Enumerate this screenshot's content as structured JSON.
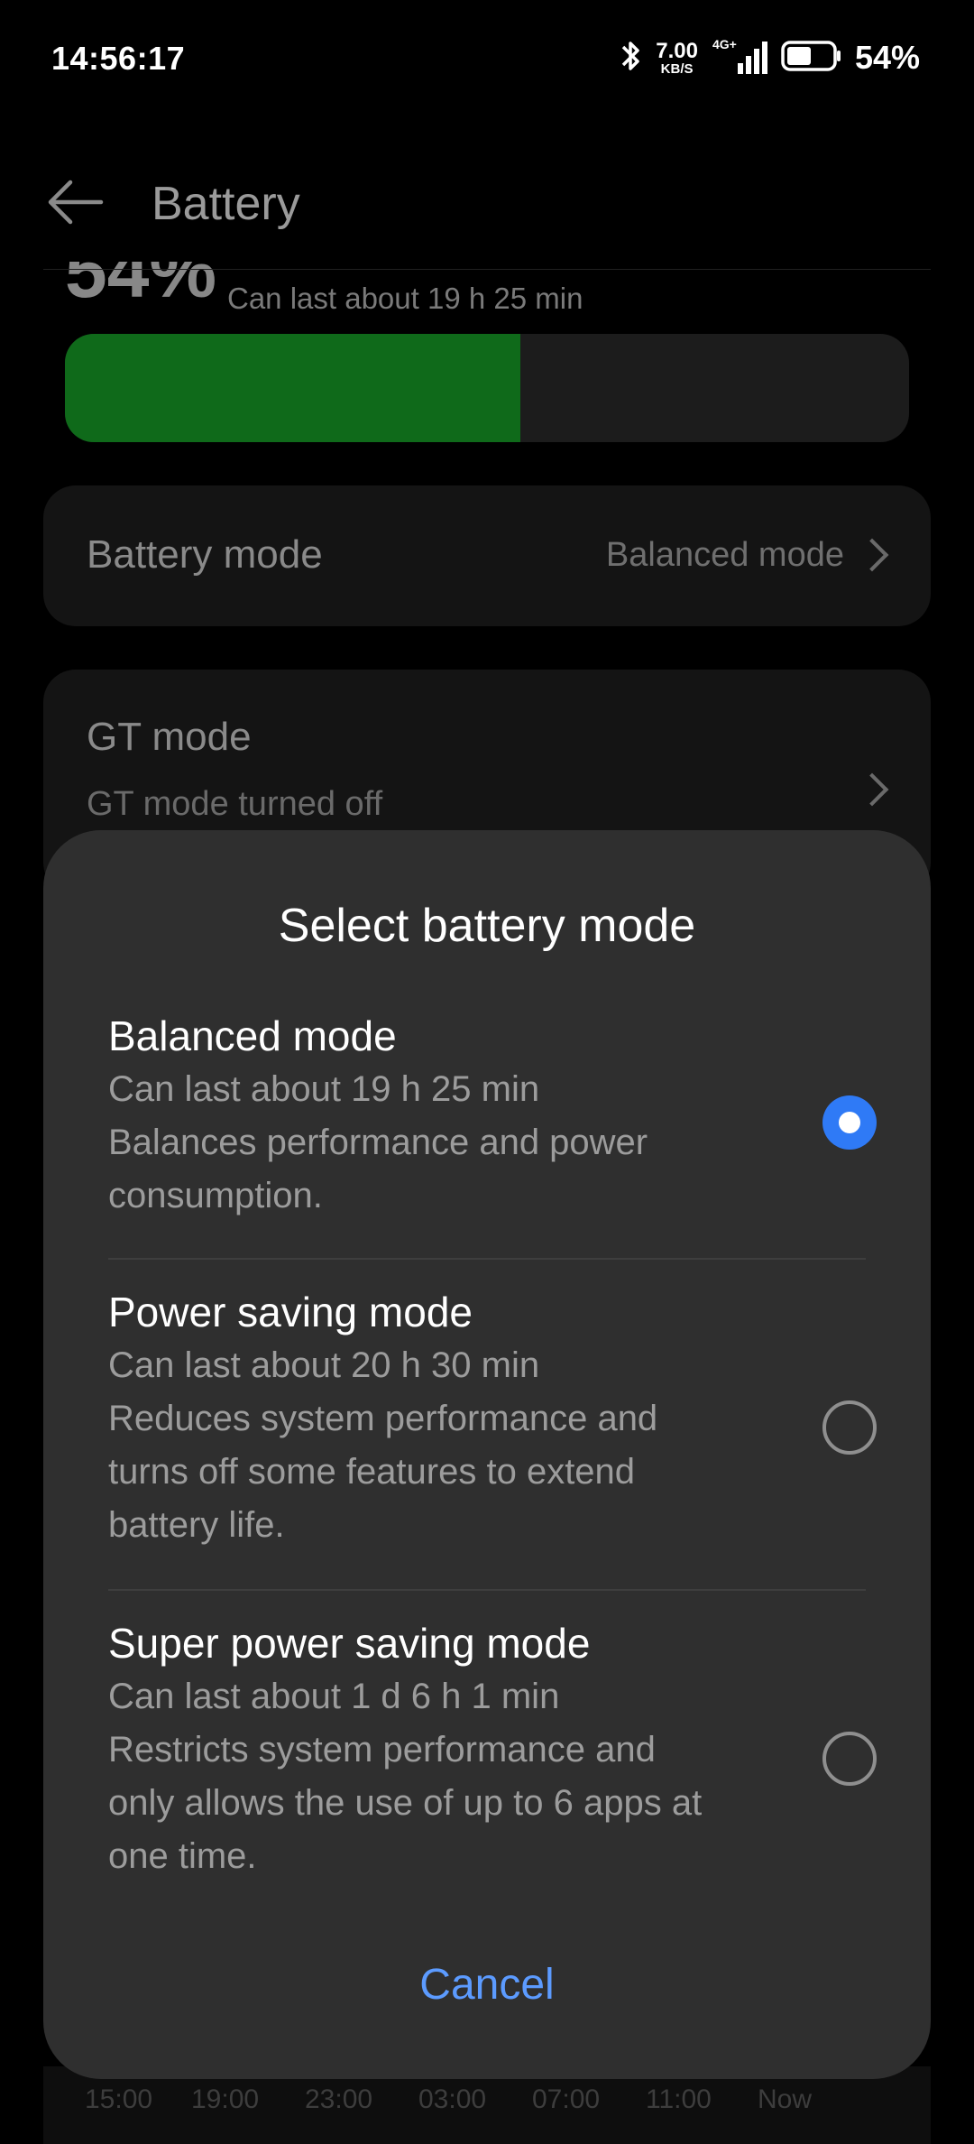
{
  "status_bar": {
    "time": "14:56:17",
    "net_speed": "7.00",
    "net_unit": "KB/S",
    "network": "4G+",
    "battery_percent": "54%",
    "battery_level_fraction": 0.54
  },
  "header": {
    "title": "Battery"
  },
  "battery": {
    "percent": "54%",
    "estimate": "Can last about 19 h 25 min",
    "fill_fraction": 0.54
  },
  "battery_mode_row": {
    "label": "Battery mode",
    "value": "Balanced mode"
  },
  "gt_mode_row": {
    "label": "GT mode",
    "status": "GT mode turned off"
  },
  "usage_chart_axis": [
    "15:00",
    "19:00",
    "23:00",
    "03:00",
    "07:00",
    "11:00",
    "Now"
  ],
  "dialog": {
    "title": "Select battery mode",
    "options": [
      {
        "title": "Balanced mode",
        "lines": [
          "Can last about 19 h 25 min",
          "Balances performance and power",
          "consumption."
        ],
        "selected": true
      },
      {
        "title": "Power saving mode",
        "lines": [
          "Can last about 20 h 30 min",
          "Reduces system performance and",
          "turns off some features to extend",
          "battery life."
        ],
        "selected": false
      },
      {
        "title": "Super power saving mode",
        "lines": [
          "Can last about 1 d 6 h 1 min",
          "Restricts system performance and",
          "only allows the use of up to 6 apps at",
          "one time."
        ],
        "selected": false
      }
    ],
    "cancel_label": "Cancel"
  },
  "colors": {
    "accent": "#2f7af6",
    "cancel_text": "#5c9bff",
    "battery_fill": "#0f6a1a",
    "sheet_bg": "#2f2f2f"
  }
}
